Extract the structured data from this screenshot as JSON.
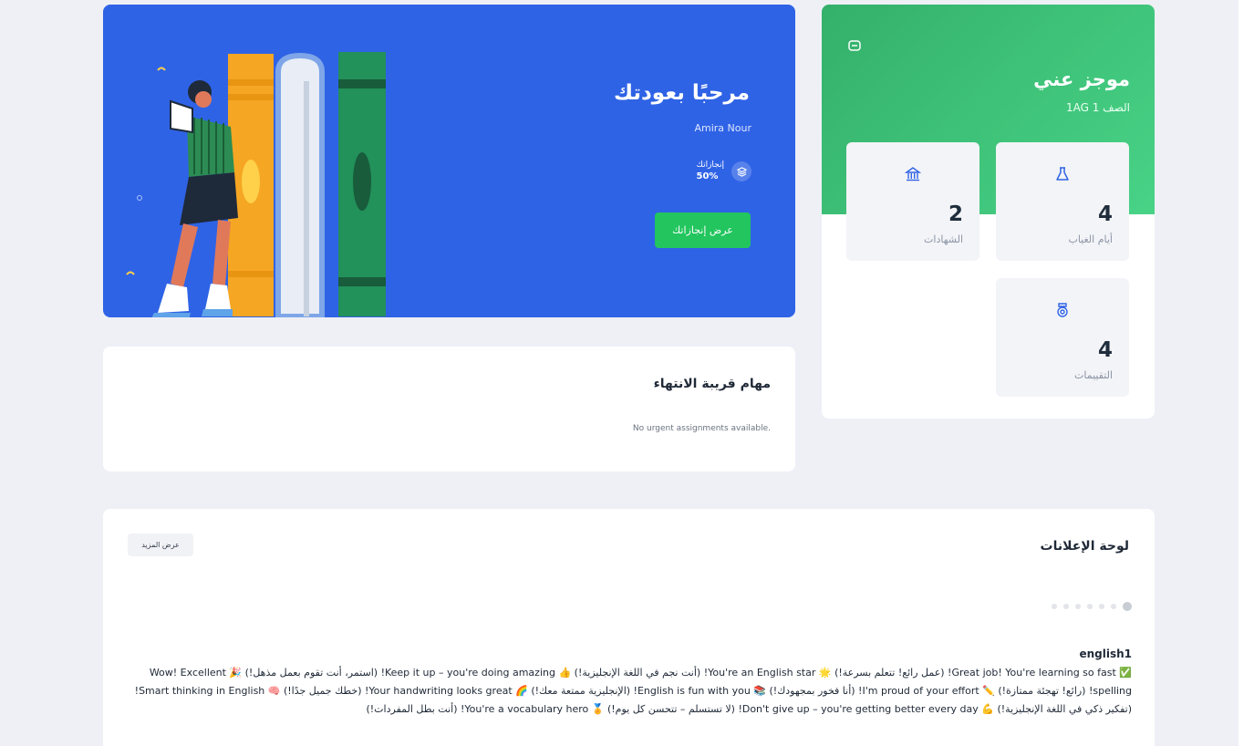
{
  "hero": {
    "title": "مرحبًا بعودتك",
    "student_name": "Amira Nour",
    "achievements_label": "إنجازاتك",
    "achievements_value": "50%",
    "button_label": "عرض إنجازاتك",
    "background_color": "#2f63e6",
    "button_color": "#22c55e"
  },
  "profile": {
    "title": "موجز عني",
    "class_label": "الصف 1 1AG",
    "stats": [
      {
        "icon": "flask-icon",
        "value": "4",
        "label": "أيام الغياب"
      },
      {
        "icon": "bank-icon",
        "value": "2",
        "label": "الشهادات"
      },
      {
        "icon": "badge-icon",
        "value": "4",
        "label": "التقييمات"
      }
    ],
    "header_color": "#3fc47a"
  },
  "tasks": {
    "title": "مهام قريبة الانتهاء",
    "empty_message": "No urgent assignments available."
  },
  "announcements": {
    "title": "لوحة الإعلانات",
    "more_button": "عرض المزيد",
    "post_title": "english1",
    "post_body": "✅ Great job! You're learning so fast! (عمل رائع! تتعلم بسرعة!) 🌟 You're an English star! (أنت نجم في اللغة الإنجليزية!) 👍 Keep it up – you're doing amazing! (استمر، أنت تقوم بعمل مذهل!) 🎉 Wow! Excellent spelling! (رائع! تهجئة ممتازة!) ✏️ I'm proud of your effort! (أنا فخور بمجهودك!) 📚 English is fun with you! (الإنجليزية ممتعة معك!) 🌈 Your handwriting looks great! (خطك جميل جدًا!) 🧠 Smart thinking in English! (تفكير ذكي في اللغة الإنجليزية!) 💪 Don't give up – you're getting better every day! (لا تستسلم – تتحسن كل يوم!) 🏅 You're a vocabulary hero! (أنت بطل المفردات!)",
    "carousel_dots": 7
  }
}
